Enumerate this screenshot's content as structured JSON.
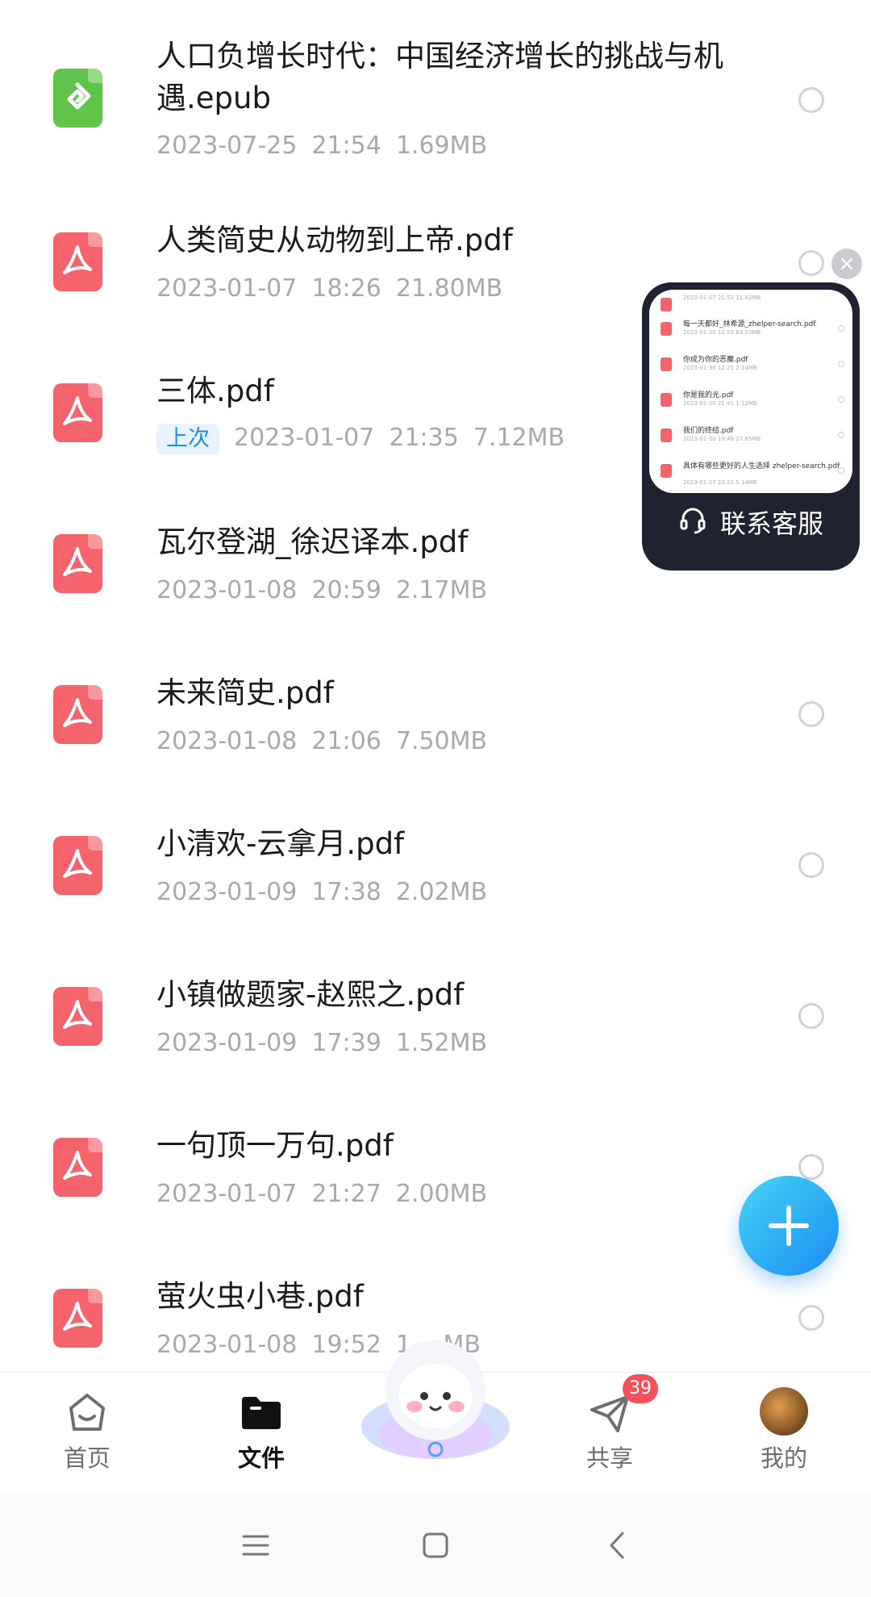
{
  "files": [
    {
      "type": "epub",
      "name_line1": "人口负增长时代：中国经济增长的挑战与机",
      "name_line2": "遇.epub",
      "date": "2023-07-25",
      "time": "21:54",
      "size": "1.69MB"
    },
    {
      "type": "pdf",
      "name_line1": "人类简史从动物到上帝.pdf",
      "name_line2": "",
      "date": "2023-01-07",
      "time": "18:26",
      "size": "21.80MB"
    },
    {
      "type": "pdf",
      "name_line1": "三体.pdf",
      "name_line2": "",
      "badge": "上次",
      "date": "2023-01-07",
      "time": "21:35",
      "size": "7.12MB"
    },
    {
      "type": "pdf",
      "name_line1": "瓦尔登湖_徐迟译本.pdf",
      "name_line2": "",
      "date": "2023-01-08",
      "time": "20:59",
      "size": "2.17MB"
    },
    {
      "type": "pdf",
      "name_line1": "未来简史.pdf",
      "name_line2": "",
      "date": "2023-01-08",
      "time": "21:06",
      "size": "7.50MB"
    },
    {
      "type": "pdf",
      "name_line1": "小清欢-云拿月.pdf",
      "name_line2": "",
      "date": "2023-01-09",
      "time": "17:38",
      "size": "2.02MB"
    },
    {
      "type": "pdf",
      "name_line1": "小镇做题家-赵熙之.pdf",
      "name_line2": "",
      "date": "2023-01-09",
      "time": "17:39",
      "size": "1.52MB"
    },
    {
      "type": "pdf",
      "name_line1": "一句顶一万句.pdf",
      "name_line2": "",
      "date": "2023-01-07",
      "time": "21:27",
      "size": "2.00MB"
    },
    {
      "type": "pdf",
      "name_line1": "萤火虫小巷.pdf",
      "name_line2": "",
      "date": "2023-01-08",
      "time": "19:52",
      "size": "1.__MB"
    }
  ],
  "service_window": {
    "label": "联系客服",
    "preview_rows": [
      {
        "name": "",
        "meta": "2023-01-07 21:53  11.43MB"
      },
      {
        "name": "每一天都好_林希源_zhelper-search.pdf",
        "meta": "2023-01-30 12:55  63.53MB"
      },
      {
        "name": "你成为你的恶魔.pdf",
        "meta": "2023-01-30 12:21  2.14MB"
      },
      {
        "name": "你是我的光.pdf",
        "meta": "2023-01-30 21:41  1.12MB"
      },
      {
        "name": "我们的终结.pdf",
        "meta": "2023-01-30 19:49  27.65MB"
      },
      {
        "name": "具体有哪些更好的人生选择 zhelper-search.pdf",
        "meta": "2023-01-27 22:21  5.14MB"
      }
    ]
  },
  "bottom_nav": {
    "home": "首页",
    "files": "文件",
    "share": "共享",
    "share_badge": "39",
    "mine": "我的"
  },
  "colors": {
    "pdf": "#f5636d",
    "epub": "#5fc54a",
    "accent": "#1c8cf2",
    "badge": "#f4505c"
  }
}
